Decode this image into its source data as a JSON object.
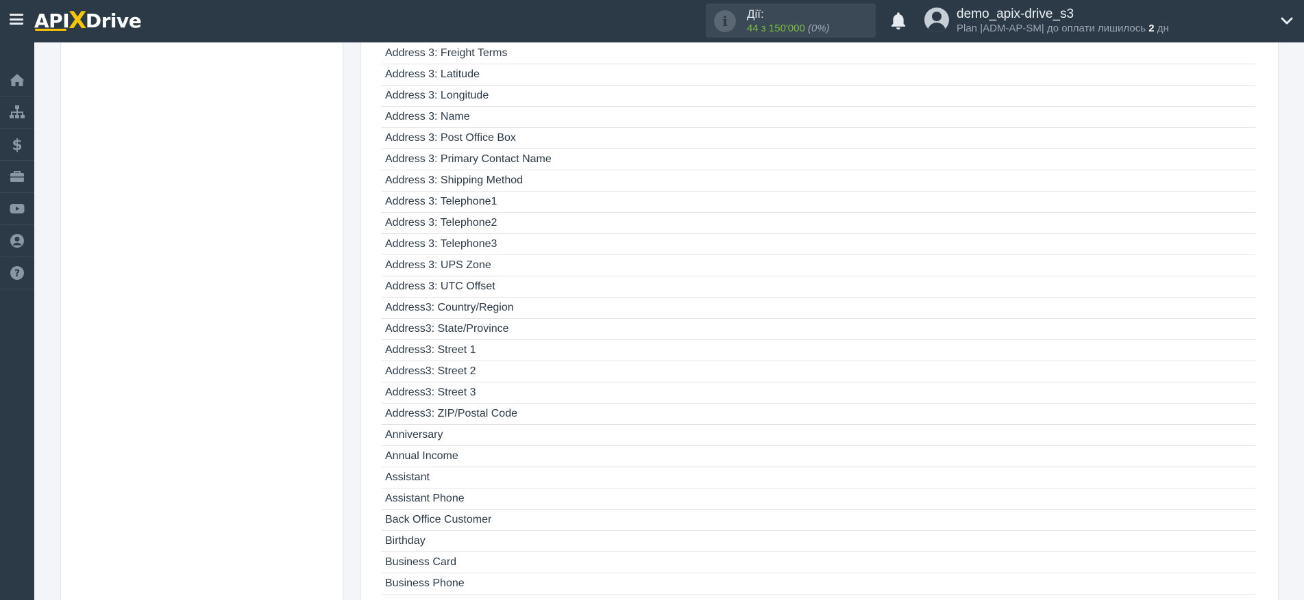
{
  "topbar": {
    "logo": {
      "part1": "API",
      "x": "X",
      "part2": "Drive"
    },
    "actions": {
      "label": "Дії:",
      "used": "44 з 150'000",
      "percent": "(0%)"
    },
    "user": {
      "name": "demo_apix-drive_s3",
      "plan_prefix": "Plan |ADM-AP-SM| до оплати лишилось ",
      "days": "2",
      "plan_suffix": " дн"
    }
  },
  "sidebar": {
    "items": [
      {
        "icon": "home-icon"
      },
      {
        "icon": "sitemap-icon"
      },
      {
        "icon": "dollar-icon"
      },
      {
        "icon": "briefcase-icon"
      },
      {
        "icon": "youtube-icon"
      },
      {
        "icon": "user-circle-icon"
      },
      {
        "icon": "question-circle-icon"
      }
    ]
  },
  "fields": [
    "Address 3: Freight Terms",
    "Address 3: Latitude",
    "Address 3: Longitude",
    "Address 3: Name",
    "Address 3: Post Office Box",
    "Address 3: Primary Contact Name",
    "Address 3: Shipping Method",
    "Address 3: Telephone1",
    "Address 3: Telephone2",
    "Address 3: Telephone3",
    "Address 3: UPS Zone",
    "Address 3: UTC Offset",
    "Address3: Country/Region",
    "Address3: State/Province",
    "Address3: Street 1",
    "Address3: Street 2",
    "Address3: Street 3",
    "Address3: ZIP/Postal Code",
    "Anniversary",
    "Annual Income",
    "Assistant",
    "Assistant Phone",
    "Back Office Customer",
    "Birthday",
    "Business Card",
    "Business Phone"
  ],
  "colors": {
    "header_bg": "#2c3a47",
    "accent_yellow": "#f7c600",
    "actions_green": "#7bbf3f"
  }
}
